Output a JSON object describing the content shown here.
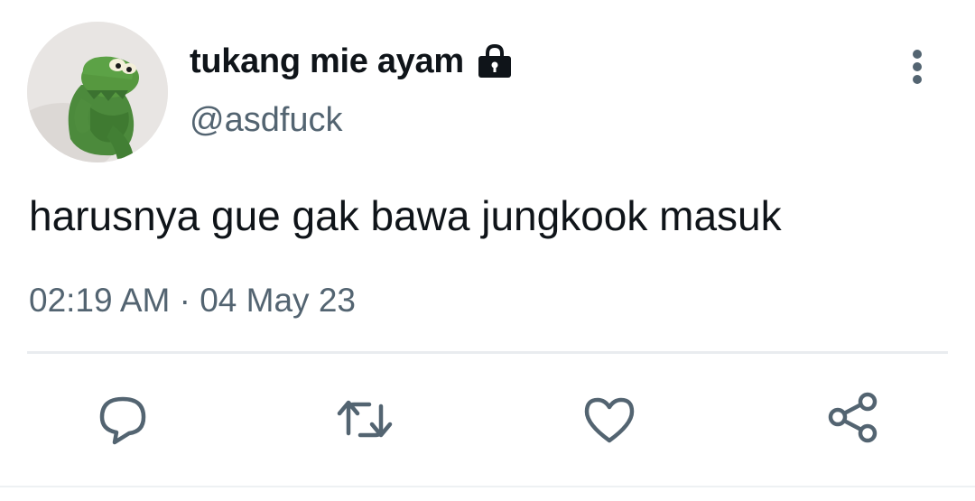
{
  "tweet": {
    "display_name": "tukang mie ayam",
    "handle": "@asdfuck",
    "protected_icon": "lock-icon",
    "avatar_icon": "kermit-avatar",
    "text": "harusnya gue gak bawa jungkook masuk",
    "timestamp": "02:19 AM · 04 May 23"
  },
  "actions": {
    "more": "more-vertical-icon",
    "reply": "reply-icon",
    "retweet": "retweet-icon",
    "like": "heart-icon",
    "share": "share-icon"
  },
  "colors": {
    "text_primary": "#0f1419",
    "text_secondary": "#536471",
    "icon": "#536471",
    "divider": "#e9ecef",
    "avatar_green": "#4a8a3a"
  }
}
